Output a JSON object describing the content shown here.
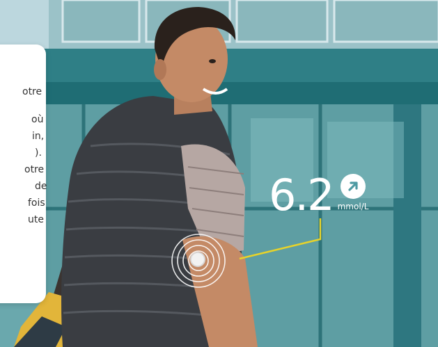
{
  "card": {
    "fragments": [
      "otre",
      "où",
      "in,",
      ").",
      "otre",
      "de",
      "fois",
      "ute"
    ]
  },
  "glucose": {
    "value": "6.2",
    "unit": "mmol/L",
    "trend_icon": "arrow-up-right-icon"
  },
  "colors": {
    "sky": "#cfe1e6",
    "glass": "#6aa8ad",
    "vest": "#3a3d42",
    "shirt": "#b6a7a3",
    "skin": "#c48a66",
    "pointer_line": "#e7d32a"
  }
}
